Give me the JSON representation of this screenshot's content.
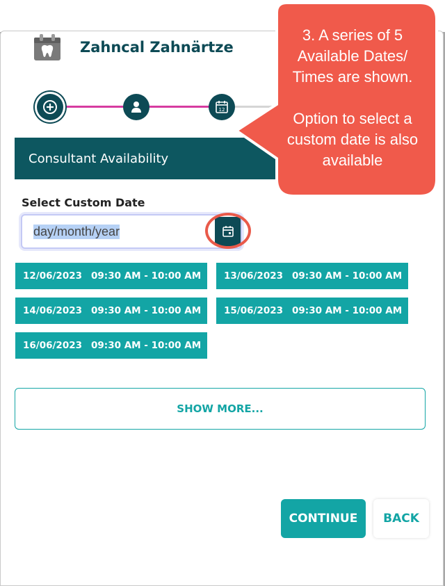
{
  "header": {
    "brand": "Zahncal Zahnärtze"
  },
  "stepper": {
    "steps": [
      {
        "name": "add",
        "icon": "plus-circle-icon",
        "state": "active"
      },
      {
        "name": "person",
        "icon": "person-icon",
        "state": "done"
      },
      {
        "name": "calendar",
        "icon": "calendar-12-icon",
        "state": "current",
        "icon_text": "12"
      }
    ]
  },
  "section": {
    "title": "Consultant Availability"
  },
  "custom_date": {
    "label": "Select Custom Date",
    "placeholder": "day/month/year"
  },
  "slots": [
    {
      "date": "12/06/2023",
      "time": "09:30 AM - 10:00 AM"
    },
    {
      "date": "13/06/2023",
      "time": "09:30 AM - 10:00 AM"
    },
    {
      "date": "14/06/2023",
      "time": "09:30 AM - 10:00 AM"
    },
    {
      "date": "15/06/2023",
      "time": "09:30 AM - 10:00 AM"
    },
    {
      "date": "16/06/2023",
      "time": "09:30 AM - 10:00 AM"
    }
  ],
  "actions": {
    "show_more": "SHOW MORE...",
    "continue": "CONTINUE",
    "back": "BACK"
  },
  "callout": {
    "line1": "3. A series of 5 Available Dates/ Times are shown.",
    "line2": "Option to select a custom date is also available"
  },
  "colors": {
    "primary_dark": "#0d4a55",
    "teal": "#13a5a5",
    "step_line": "#d63ba0",
    "callout": "#f05a4b"
  }
}
